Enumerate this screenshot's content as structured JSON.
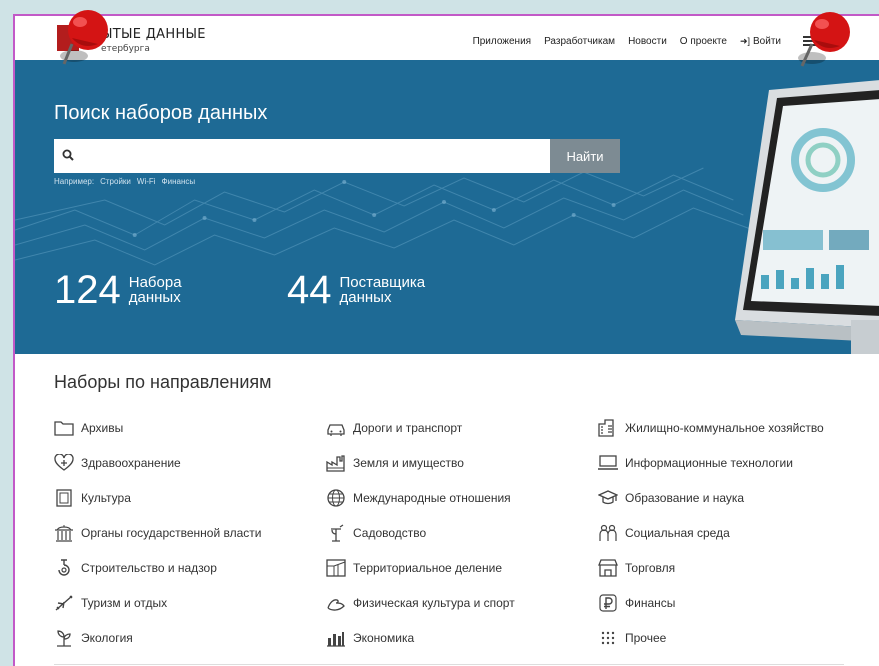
{
  "header": {
    "logo_title": "ЫТЫЕ ДАННЫЕ",
    "logo_subtitle": "етербурга",
    "nav": [
      "Приложения",
      "Разработчикам",
      "Новости",
      "О проекте"
    ],
    "login": "Войти"
  },
  "hero": {
    "title": "Поиск наборов данных",
    "search": {
      "value": "",
      "placeholder": "",
      "button_label": "Найти"
    },
    "examples": {
      "prefix": "Например:",
      "items": [
        "Стройки",
        "Wi-Fi",
        "Финансы"
      ]
    },
    "stats": [
      {
        "number": "124",
        "line1": "Набора",
        "line2": "данных"
      },
      {
        "number": "44",
        "line1": "Поставщика",
        "line2": "данных"
      }
    ]
  },
  "categories": {
    "title": "Наборы по направлениям",
    "items": [
      {
        "label": "Архивы",
        "icon": "folder-icon"
      },
      {
        "label": "Дороги и транспорт",
        "icon": "car-icon"
      },
      {
        "label": "Жилищно-коммунальное хозяйство",
        "icon": "buildings-icon"
      },
      {
        "label": "Здравоохранение",
        "icon": "heart-plus-icon"
      },
      {
        "label": "Земля и имущество",
        "icon": "factory-icon"
      },
      {
        "label": "Информационные технологии",
        "icon": "laptop-icon"
      },
      {
        "label": "Культура",
        "icon": "painting-icon"
      },
      {
        "label": "Международные отношения",
        "icon": "globe-icon"
      },
      {
        "label": "Образование и наука",
        "icon": "graduation-cap-icon"
      },
      {
        "label": "Органы государственной власти",
        "icon": "government-building-icon"
      },
      {
        "label": "Садоводство",
        "icon": "watering-can-icon"
      },
      {
        "label": "Социальная среда",
        "icon": "people-icon"
      },
      {
        "label": "Строительство и надзор",
        "icon": "crane-hook-icon"
      },
      {
        "label": "Территориальное деление",
        "icon": "map-grid-icon"
      },
      {
        "label": "Торговля",
        "icon": "shop-icon"
      },
      {
        "label": "Туризм и отдых",
        "icon": "airplane-icon"
      },
      {
        "label": "Физическая культура и спорт",
        "icon": "muscle-icon"
      },
      {
        "label": "Финансы",
        "icon": "ruble-icon"
      },
      {
        "label": "Экология",
        "icon": "plant-icon"
      },
      {
        "label": "Экономика",
        "icon": "chart-bars-icon"
      },
      {
        "label": "Прочее",
        "icon": "dots-grid-icon"
      }
    ]
  },
  "colors": {
    "hero_bg": "#1e6a95",
    "search_button": "#7d8b93",
    "frame_border": "#c259c7",
    "pin_red": "#d41414",
    "logo_red": "#b31d1d"
  }
}
